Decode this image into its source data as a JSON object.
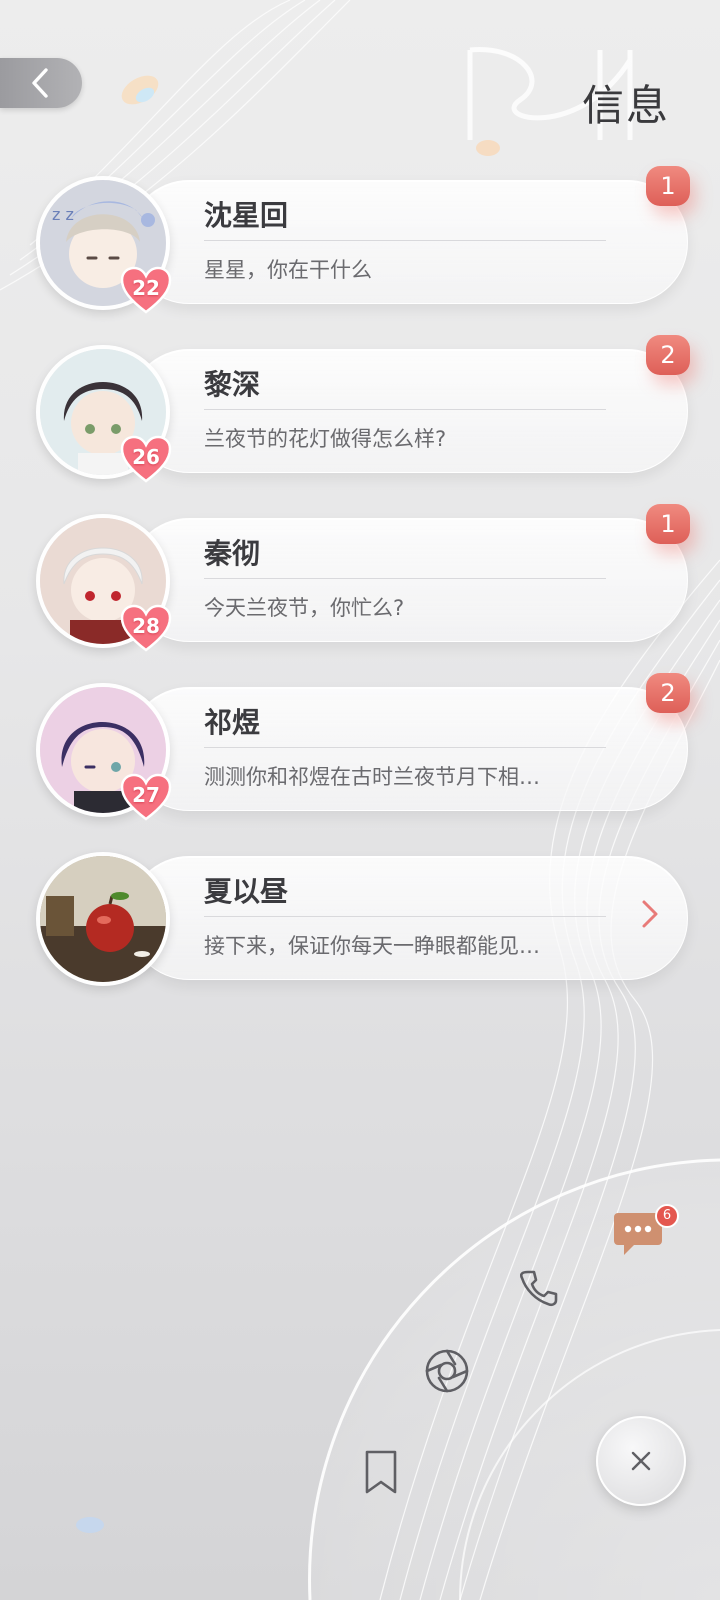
{
  "header": {
    "title": "信息",
    "back_icon": "chevron-left-icon"
  },
  "contacts": [
    {
      "name": "沈星回",
      "preview": "星星，你在干什么",
      "level": "22",
      "unread": "1",
      "avatar_color": "#cfd3de"
    },
    {
      "name": "黎深",
      "preview": "兰夜节的花灯做得怎么样?",
      "level": "26",
      "unread": "2",
      "avatar_color": "#dde8ea"
    },
    {
      "name": "秦彻",
      "preview": "今天兰夜节，你忙么?",
      "level": "28",
      "unread": "1",
      "avatar_color": "#e9d4cd"
    },
    {
      "name": "祁煜",
      "preview": "测测你和祁煜在古时兰夜节月下相…",
      "level": "27",
      "unread": "2",
      "avatar_color": "#e6c9dd"
    },
    {
      "name": "夏以昼",
      "preview": "接下来，保证你每天一睁眼都能见…",
      "level": "",
      "unread": "",
      "avatar_color": "#5a4a3c"
    }
  ],
  "menu": {
    "chat_badge": "6",
    "items": [
      "chat-icon",
      "phone-icon",
      "moments-icon",
      "bookmark-icon",
      "close-icon"
    ]
  },
  "colors": {
    "badge": "#e4645c",
    "heart": "#f56b7e",
    "text_primary": "#3b3b3f",
    "text_secondary": "#6a6a6e"
  }
}
